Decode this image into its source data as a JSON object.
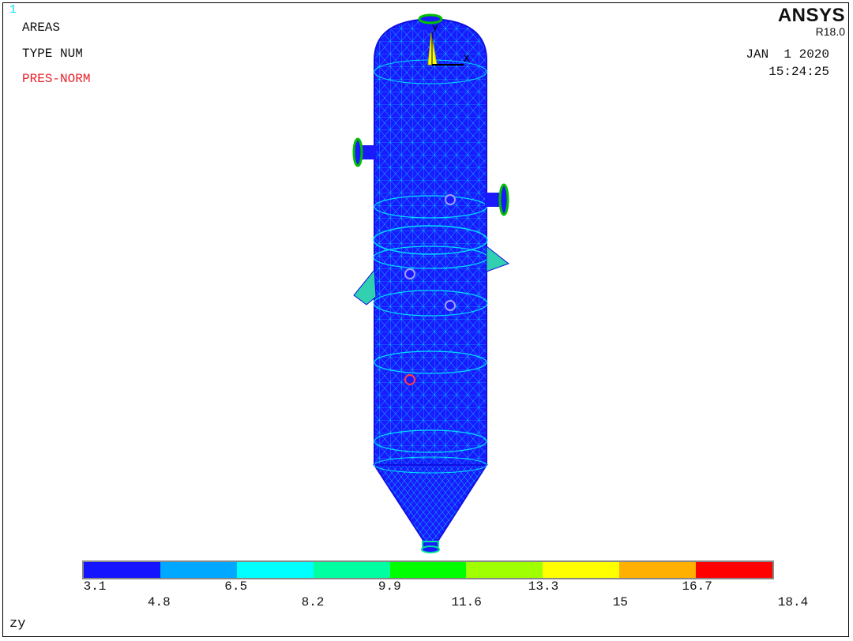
{
  "window": {
    "number": "1"
  },
  "labels": {
    "areas": "AREAS",
    "type": "TYPE NUM",
    "pres": "PRES-NORM"
  },
  "brand": {
    "logo": "ANSYS",
    "release": "R18.0"
  },
  "stamp": {
    "date": "JAN  1 2020",
    "time": "15:24:25"
  },
  "axes": {
    "y": "Y",
    "x": "X"
  },
  "view": {
    "label": "zy"
  },
  "legend": {
    "colors": [
      "#1414ff",
      "#00a8ff",
      "#00ffff",
      "#00ffa0",
      "#00ff00",
      "#a0ff00",
      "#ffff00",
      "#ffb000",
      "#ff0000"
    ],
    "ticks_top": [
      "3.1",
      "6.5",
      "9.9",
      "13.3",
      "16.7"
    ],
    "ticks_bottom": [
      "4.8",
      "8.2",
      "11.6",
      "15",
      "18.4"
    ]
  },
  "colors": {
    "mesh": "#1a1aff",
    "mesh_line": "#00d8ff",
    "background": "#ffffff"
  }
}
